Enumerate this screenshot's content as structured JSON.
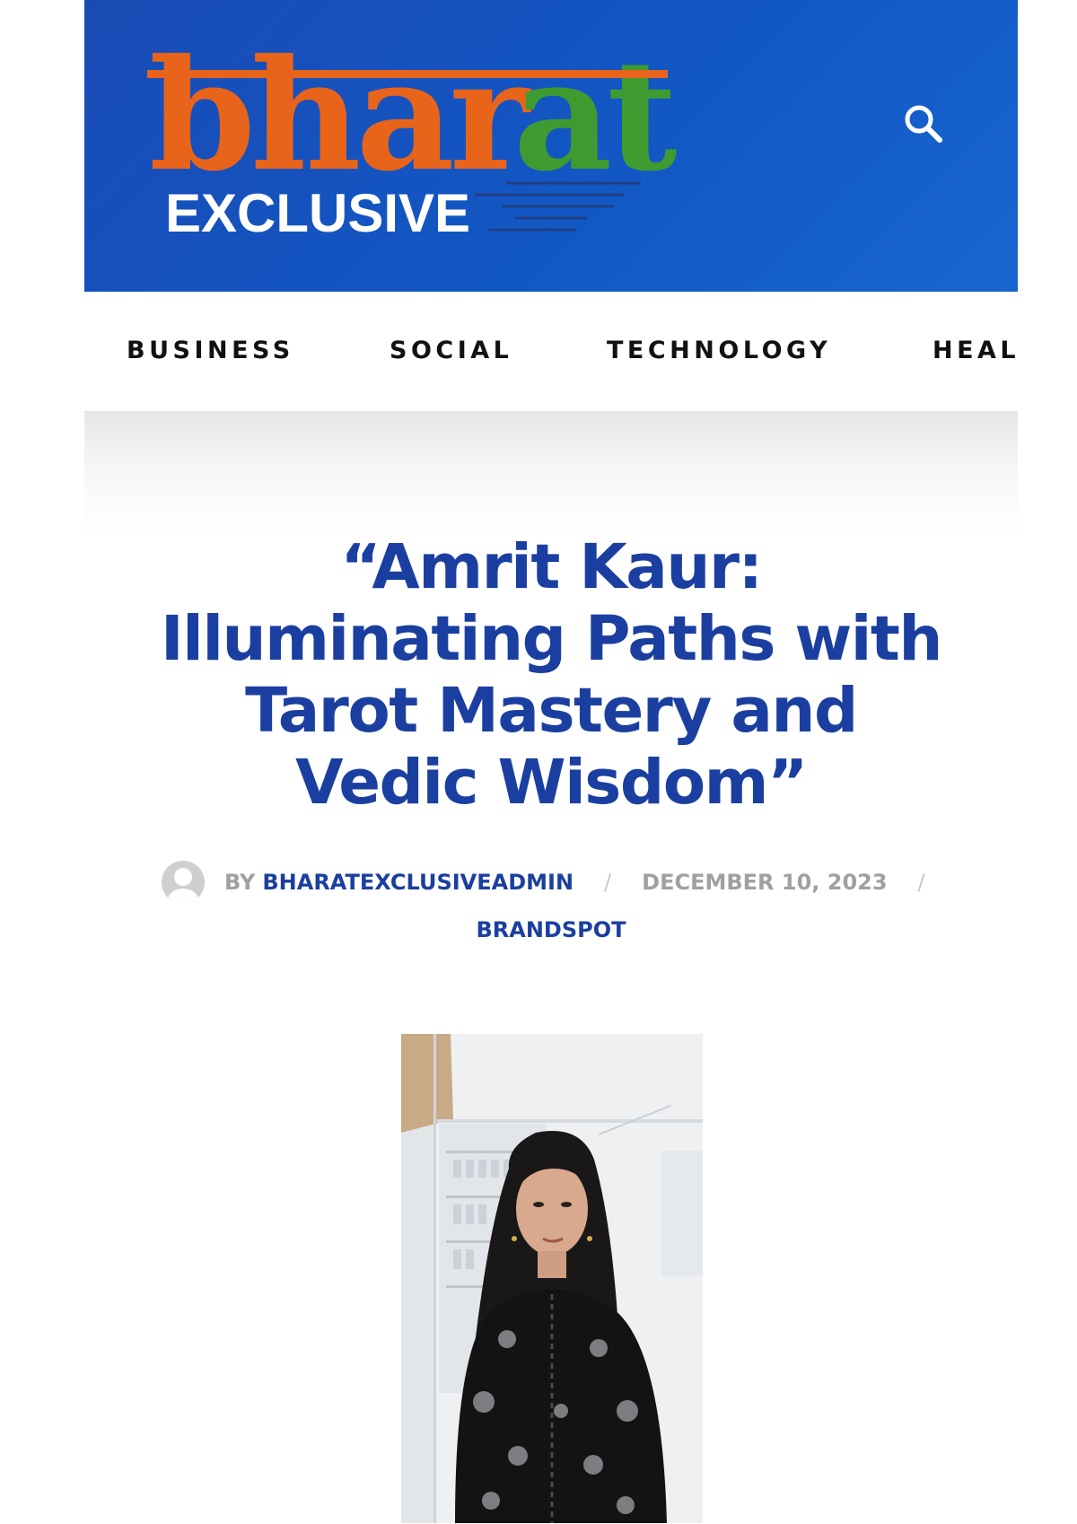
{
  "site": {
    "logo_word_bha": "bhar",
    "logo_word_at": "at",
    "logo_sub": "EXCLUSIVE",
    "search_icon": "search-icon"
  },
  "nav": {
    "items": [
      {
        "label": "BUSINESS"
      },
      {
        "label": "SOCIAL"
      },
      {
        "label": "TECHNOLOGY"
      },
      {
        "label": "HEAL"
      }
    ]
  },
  "article": {
    "title_lines": [
      "“Amrit Kaur:",
      "Illuminating Paths with",
      "Tarot Mastery and",
      "Vedic Wisdom”"
    ],
    "by": "BY",
    "author": "BHARATEXCLUSIVEADMIN",
    "separator": "/",
    "date": "DECEMBER 10, 2023",
    "category": "BRANDSPOT",
    "avatar_icon": "user-avatar-icon"
  },
  "colors": {
    "header_blue": "#1257c4",
    "logo_orange": "#e8641b",
    "logo_green": "#3f9b2f",
    "title_blue": "#1b3fa0",
    "meta_gray": "#a0a0a0"
  }
}
